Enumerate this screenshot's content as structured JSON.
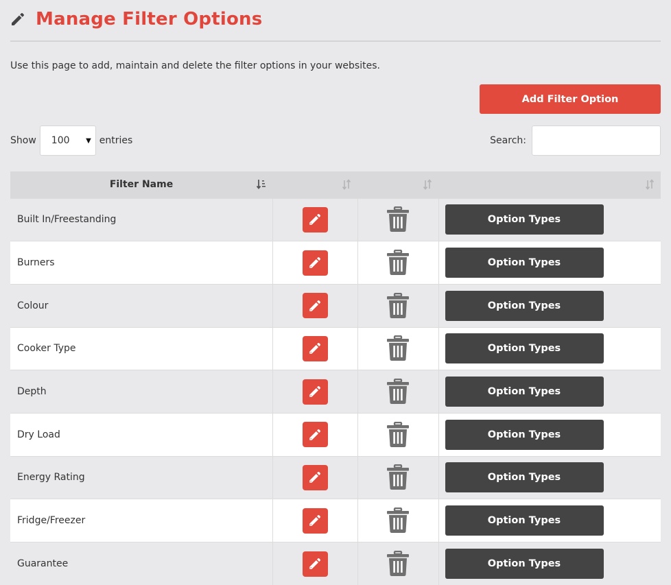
{
  "header": {
    "title": "Manage Filter Options",
    "title_icon": "pencil-icon",
    "description": "Use this page to add, maintain and delete the filter options in your websites."
  },
  "colors": {
    "accent": "#e24a3e",
    "dark_button": "#444444",
    "trash_icon": "#6f6f6f"
  },
  "toolbar": {
    "add_label": "Add Filter Option",
    "show_label": "Show",
    "entries_value": "100",
    "entries_label": "entries",
    "search_label": "Search:",
    "search_value": ""
  },
  "table": {
    "columns": [
      {
        "label": "Filter Name",
        "sort": "ascending"
      },
      {
        "label": "",
        "sort": "none"
      },
      {
        "label": "",
        "sort": "none"
      },
      {
        "label": "",
        "sort": "none"
      }
    ],
    "action_label": "Option Types",
    "rows": [
      {
        "name": "Built In/Freestanding"
      },
      {
        "name": "Burners"
      },
      {
        "name": "Colour"
      },
      {
        "name": "Cooker Type"
      },
      {
        "name": "Depth"
      },
      {
        "name": "Dry Load"
      },
      {
        "name": "Energy Rating"
      },
      {
        "name": "Fridge/Freezer"
      },
      {
        "name": "Guarantee"
      }
    ]
  }
}
